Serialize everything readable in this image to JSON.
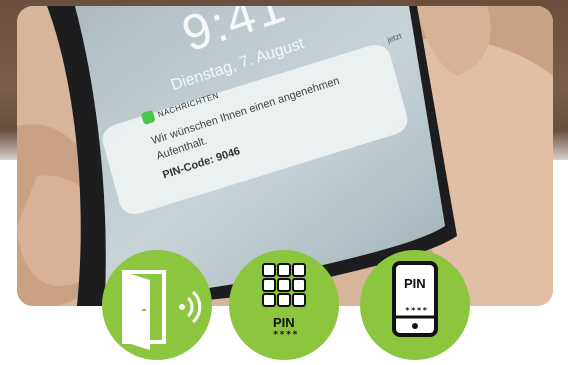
{
  "lockscreen": {
    "time": "9:41",
    "date": "Dienstag, 7. August"
  },
  "notification": {
    "app": "NACHRICHTEN",
    "time": "jetzt",
    "line1": "Wir wünschen Ihnen einen angenehmen",
    "line2": "Aufenthalt.",
    "pin": "PIN-Code: 9046"
  },
  "icons": [
    {
      "name": "door-nfc-icon"
    },
    {
      "name": "keypad-pin-icon",
      "label": "PIN",
      "mask": "****"
    },
    {
      "name": "smartphone-pin-icon",
      "label": "PIN",
      "mask": "****"
    }
  ],
  "colors": {
    "accent_green": "#8cc63f",
    "icon_stroke": "#111111"
  }
}
